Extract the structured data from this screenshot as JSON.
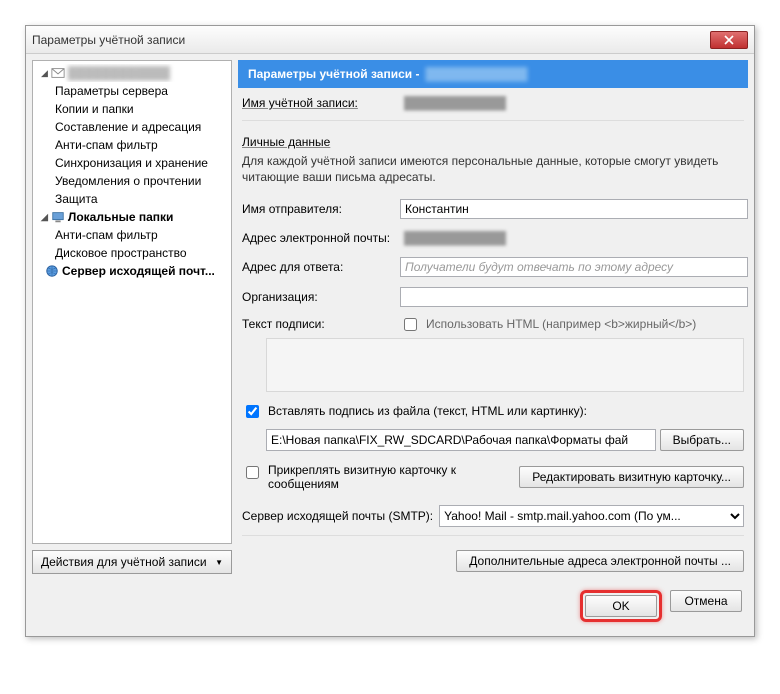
{
  "window": {
    "title": "Параметры учётной записи"
  },
  "sidebar": {
    "account_masked": "████████████",
    "items": [
      "Параметры сервера",
      "Копии и папки",
      "Составление и адресация",
      "Анти-спам фильтр",
      "Синхронизация и хранение",
      "Уведомления о прочтении",
      "Защита"
    ],
    "local_folders": "Локальные папки",
    "local_items": [
      "Анти-спам фильтр",
      "Дисковое пространство"
    ],
    "smtp": "Сервер исходящей почт...",
    "actions_button": "Действия для учётной записи"
  },
  "banner": {
    "prefix": "Параметры учётной записи -",
    "masked": "████████████"
  },
  "account_name": {
    "label": "Имя учётной записи:",
    "masked": "████████████"
  },
  "personal": {
    "title": "Личные данные",
    "desc": "Для каждой учётной записи имеются персональные данные, которые смогут увидеть читающие ваши письма адресаты.",
    "sender_label": "Имя отправителя:",
    "sender_value": "Константин",
    "email_label": "Адрес электронной почты:",
    "email_masked": "████████████",
    "reply_label": "Адрес для ответа:",
    "reply_placeholder": "Получатели будут отвечать по этому адресу",
    "org_label": "Организация:",
    "org_value": ""
  },
  "signature": {
    "label": "Текст подписи:",
    "html_checkbox": "Использовать HTML (например <b>жирный</b>)",
    "from_file": "Вставлять подпись из файла (текст, HTML или картинку):",
    "file_path": "E:\\Новая папка\\FIX_RW_SDCARD\\Рабочая папка\\Форматы фай",
    "browse": "Выбрать...",
    "vcard": "Прикреплять визитную карточку к сообщениям",
    "edit_vcard": "Редактировать визитную карточку..."
  },
  "smtp": {
    "label": "Сервер исходящей почты (SMTP):",
    "value": "Yahoo! Mail - smtp.mail.yahoo.com (По ум..."
  },
  "extra": {
    "more_addresses": "Дополнительные адреса электронной почты ..."
  },
  "footer": {
    "ok": "OK",
    "cancel": "Отмена"
  }
}
